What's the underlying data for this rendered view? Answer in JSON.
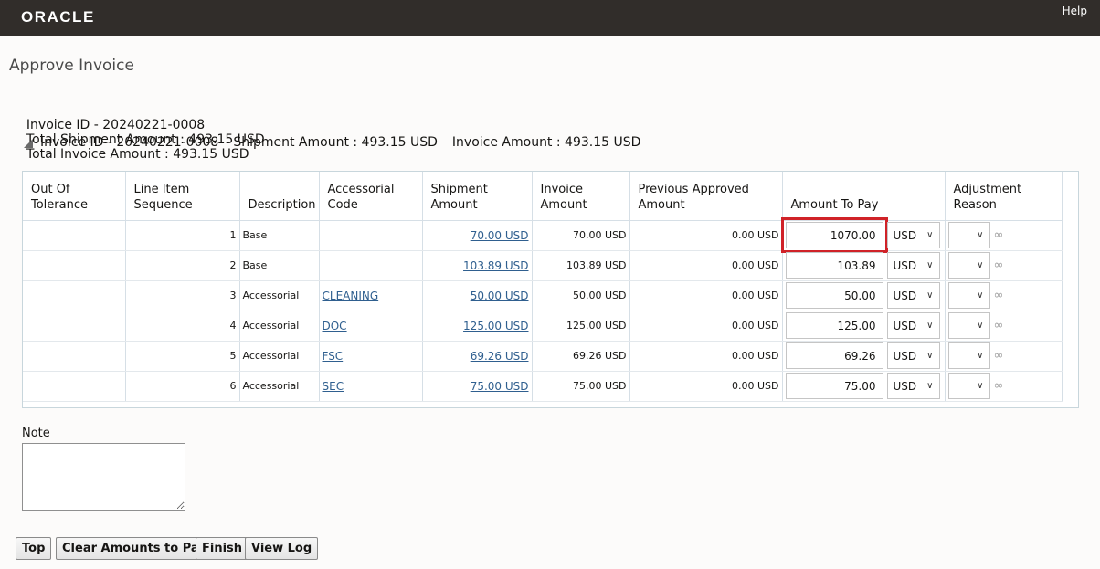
{
  "header": {
    "logo": "ORACLE",
    "help": "Help"
  },
  "page": {
    "title": "Approve Invoice"
  },
  "summary": {
    "invoice_id": "Invoice ID - 20240221-0008",
    "total_shipment": "Total Shipment Amount : 493.15 USD",
    "total_invoice": "Total Invoice Amount : 493.15 USD"
  },
  "subheader": {
    "invoice_id": "Invoice ID - 20240221-0008",
    "shipment": "Shipment Amount : 493.15 USD",
    "invoice": "Invoice Amount : 493.15 USD"
  },
  "table": {
    "headers": {
      "out_of_tolerance": "Out Of Tolerance",
      "line_item_sequence": "Line Item Sequence",
      "description": "Description",
      "accessorial_code": "Accessorial Code",
      "shipment_amount": "Shipment Amount",
      "invoice_amount": "Invoice Amount",
      "previous_approved": "Previous Approved Amount",
      "amount_to_pay": "Amount To Pay",
      "adjustment_reason": "Adjustment Reason"
    },
    "rows": [
      {
        "seq": "1",
        "desc": "Base",
        "code": "",
        "ship": "70.00 USD",
        "inv": "70.00 USD",
        "prev": "0.00 USD",
        "pay": "1070.00",
        "cur": "USD"
      },
      {
        "seq": "2",
        "desc": "Base",
        "code": "",
        "ship": "103.89 USD",
        "inv": "103.89 USD",
        "prev": "0.00 USD",
        "pay": "103.89",
        "cur": "USD"
      },
      {
        "seq": "3",
        "desc": "Accessorial",
        "code": "CLEANING",
        "ship": "50.00 USD",
        "inv": "50.00 USD",
        "prev": "0.00 USD",
        "pay": "50.00",
        "cur": "USD"
      },
      {
        "seq": "4",
        "desc": "Accessorial",
        "code": "DOC",
        "ship": "125.00 USD",
        "inv": "125.00 USD",
        "prev": "0.00 USD",
        "pay": "125.00",
        "cur": "USD"
      },
      {
        "seq": "5",
        "desc": "Accessorial",
        "code": "FSC",
        "ship": "69.26 USD",
        "inv": "69.26 USD",
        "prev": "0.00 USD",
        "pay": "69.26",
        "cur": "USD"
      },
      {
        "seq": "6",
        "desc": "Accessorial",
        "code": "SEC",
        "ship": "75.00 USD",
        "inv": "75.00 USD",
        "prev": "0.00 USD",
        "pay": "75.00",
        "cur": "USD"
      }
    ]
  },
  "note": {
    "label": "Note",
    "value": ""
  },
  "buttons": {
    "top": "Top",
    "clear": "Clear Amounts to Pay",
    "finish": "Finish",
    "view_log": "View Log"
  },
  "icons": {
    "reason_icon": "glasses-icon",
    "select_chevron": "chevron-down-icon"
  },
  "colors": {
    "topbar": "#312d2a",
    "highlight": "#d02228",
    "link": "#2f5f8f"
  }
}
